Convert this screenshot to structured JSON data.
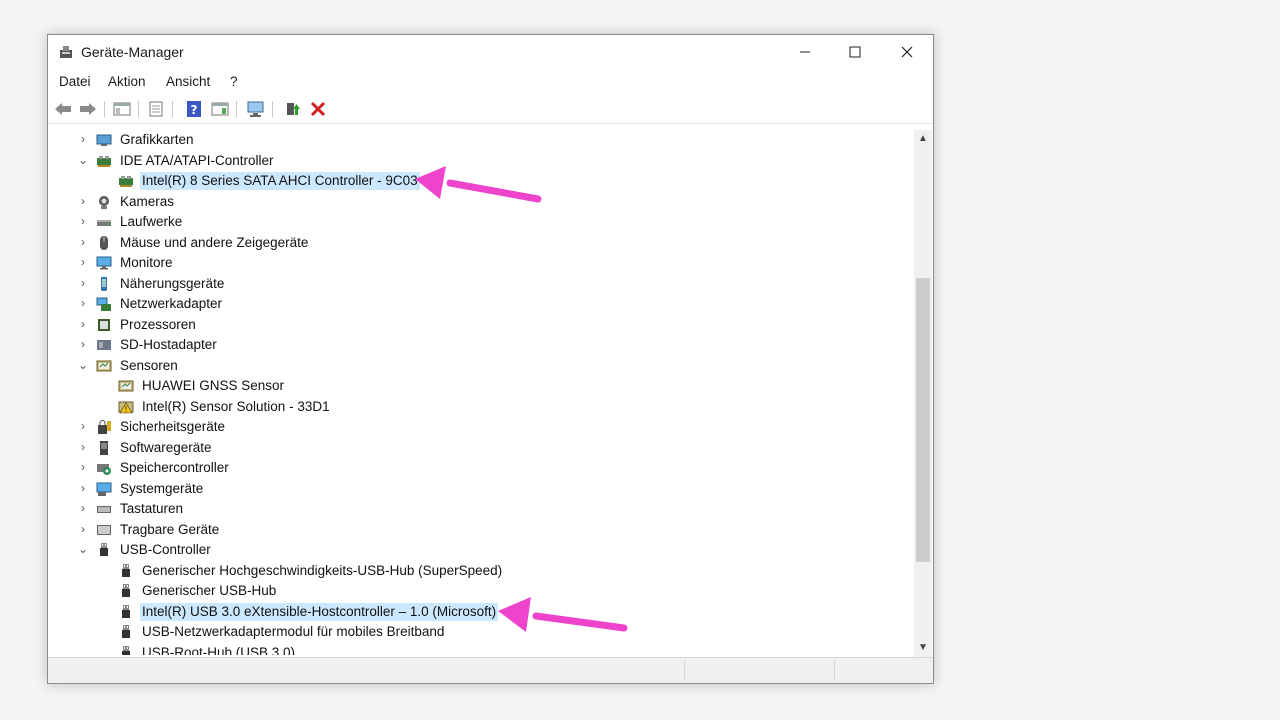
{
  "window": {
    "title": "Geräte-Manager",
    "minimize_label": "—",
    "maximize_label": "☐",
    "close_label": "✕"
  },
  "menu": [
    "Datei",
    "Aktion",
    "Ansicht",
    "?"
  ],
  "toolbar": [
    "back",
    "forward",
    "show-hide-console-tree",
    "properties",
    "help",
    "action-pane",
    "scan-hardware",
    "enable-driver",
    "uninstall"
  ],
  "tree": [
    {
      "label": "Grafikkarten",
      "level": 0,
      "expanded": false,
      "icon": "display-adapter-icon"
    },
    {
      "label": "IDE ATA/ATAPI-Controller",
      "level": 0,
      "expanded": true,
      "icon": "ide-controller-icon"
    },
    {
      "label": "Intel(R) 8 Series SATA AHCI Controller - 9C03",
      "level": 1,
      "icon": "ide-controller-icon",
      "selected": true
    },
    {
      "label": "Kameras",
      "level": 0,
      "expanded": false,
      "icon": "camera-icon"
    },
    {
      "label": "Laufwerke",
      "level": 0,
      "expanded": false,
      "icon": "disk-drive-icon"
    },
    {
      "label": "Mäuse und andere Zeigegeräte",
      "level": 0,
      "expanded": false,
      "icon": "mouse-icon"
    },
    {
      "label": "Monitore",
      "level": 0,
      "expanded": false,
      "icon": "monitor-icon"
    },
    {
      "label": "Näherungsgeräte",
      "level": 0,
      "expanded": false,
      "icon": "proximity-device-icon"
    },
    {
      "label": "Netzwerkadapter",
      "level": 0,
      "expanded": false,
      "icon": "network-adapter-icon"
    },
    {
      "label": "Prozessoren",
      "level": 0,
      "expanded": false,
      "icon": "processor-icon"
    },
    {
      "label": "SD-Hostadapter",
      "level": 0,
      "expanded": false,
      "icon": "sd-host-adapter-icon"
    },
    {
      "label": "Sensoren",
      "level": 0,
      "expanded": true,
      "icon": "sensor-icon"
    },
    {
      "label": "HUAWEI GNSS Sensor",
      "level": 1,
      "icon": "sensor-icon"
    },
    {
      "label": "Intel(R) Sensor Solution - 33D1",
      "level": 1,
      "icon": "sensor-warning-icon"
    },
    {
      "label": "Sicherheitsgeräte",
      "level": 0,
      "expanded": false,
      "icon": "security-device-icon"
    },
    {
      "label": "Softwaregeräte",
      "level": 0,
      "expanded": false,
      "icon": "software-device-icon"
    },
    {
      "label": "Speichercontroller",
      "level": 0,
      "expanded": false,
      "icon": "storage-controller-icon"
    },
    {
      "label": "Systemgeräte",
      "level": 0,
      "expanded": false,
      "icon": "system-device-icon"
    },
    {
      "label": "Tastaturen",
      "level": 0,
      "expanded": false,
      "icon": "keyboard-icon"
    },
    {
      "label": "Tragbare Geräte",
      "level": 0,
      "expanded": false,
      "icon": "portable-device-icon"
    },
    {
      "label": "USB-Controller",
      "level": 0,
      "expanded": true,
      "icon": "usb-icon"
    },
    {
      "label": "Generischer Hochgeschwindigkeits-USB-Hub (SuperSpeed)",
      "level": 1,
      "icon": "usb-icon"
    },
    {
      "label": "Generischer USB-Hub",
      "level": 1,
      "icon": "usb-icon"
    },
    {
      "label": "Intel(R) USB 3.0 eXtensible-Hostcontroller – 1.0 (Microsoft)",
      "level": 1,
      "icon": "usb-icon",
      "selected": true
    },
    {
      "label": "USB-Netzwerkadaptermodul für mobiles Breitband",
      "level": 1,
      "icon": "usb-icon"
    },
    {
      "label": "USB-Root-Hub (USB 3.0)",
      "level": 1,
      "icon": "usb-icon"
    }
  ],
  "colors": {
    "annotation_arrow": "#ee44cc",
    "selection": "#cce8ff"
  }
}
